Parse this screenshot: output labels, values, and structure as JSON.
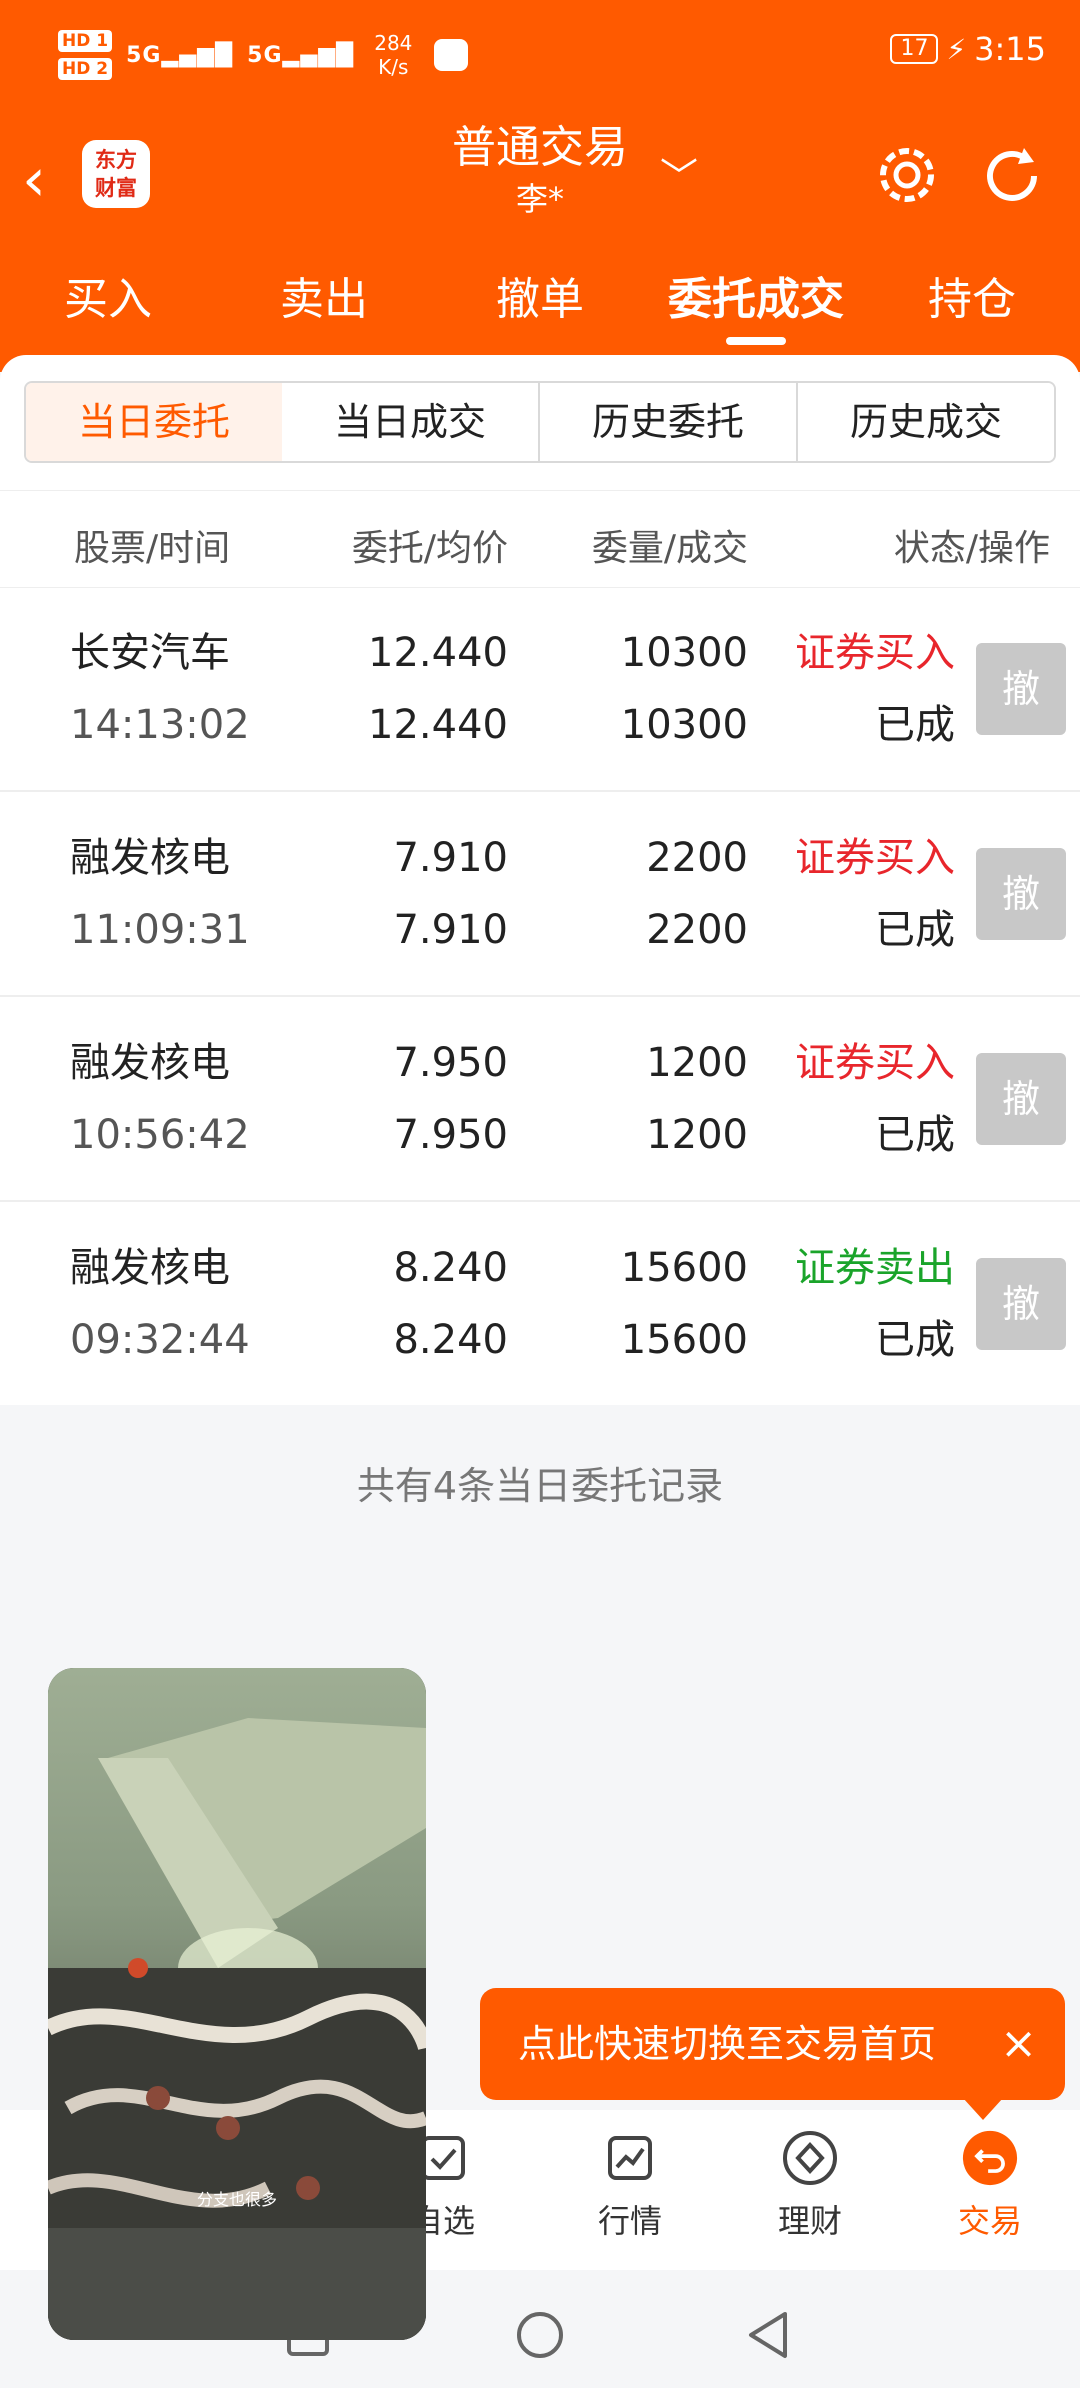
{
  "status_bar": {
    "hd1": "HD 1",
    "hd2": "HD 2",
    "signal1": "5G",
    "signal2": "5G",
    "speed_value": "284",
    "speed_unit": "K/s",
    "battery": "17",
    "time": "3:15"
  },
  "header": {
    "logo_line1": "东方",
    "logo_line2": "财富",
    "title": "普通交易",
    "account": "李*"
  },
  "nav_tabs": [
    "买入",
    "卖出",
    "撤单",
    "委托成交",
    "持仓"
  ],
  "sub_tabs": [
    "当日委托",
    "当日成交",
    "历史委托",
    "历史成交"
  ],
  "columns": [
    "股票/时间",
    "委托/均价",
    "委量/成交",
    "状态/操作"
  ],
  "orders": [
    {
      "name": "长安汽车",
      "time": "14:13:02",
      "price": "12.440",
      "avg": "12.440",
      "qty": "10300",
      "filled": "10300",
      "op": "证券买入",
      "op_type": "buy",
      "status": "已成",
      "cancel": "撤"
    },
    {
      "name": "融发核电",
      "time": "11:09:31",
      "price": "7.910",
      "avg": "7.910",
      "qty": "2200",
      "filled": "2200",
      "op": "证券买入",
      "op_type": "buy",
      "status": "已成",
      "cancel": "撤"
    },
    {
      "name": "融发核电",
      "time": "10:56:42",
      "price": "7.950",
      "avg": "7.950",
      "qty": "1200",
      "filled": "1200",
      "op": "证券买入",
      "op_type": "buy",
      "status": "已成",
      "cancel": "撤"
    },
    {
      "name": "融发核电",
      "time": "09:32:44",
      "price": "8.240",
      "avg": "8.240",
      "qty": "15600",
      "filled": "15600",
      "op": "证券卖出",
      "op_type": "sell",
      "status": "已成",
      "cancel": "撤"
    }
  ],
  "footer_text": "共有4条当日委托记录",
  "tooltip": {
    "text": "点此快速切换至交易首页",
    "close": "×"
  },
  "bottom_nav": [
    "自选",
    "行情",
    "理财",
    "交易"
  ],
  "pip_caption": "分支也很多",
  "colors": {
    "brand": "#ff5a00",
    "buy": "#e8262c",
    "sell": "#1aa42a"
  }
}
